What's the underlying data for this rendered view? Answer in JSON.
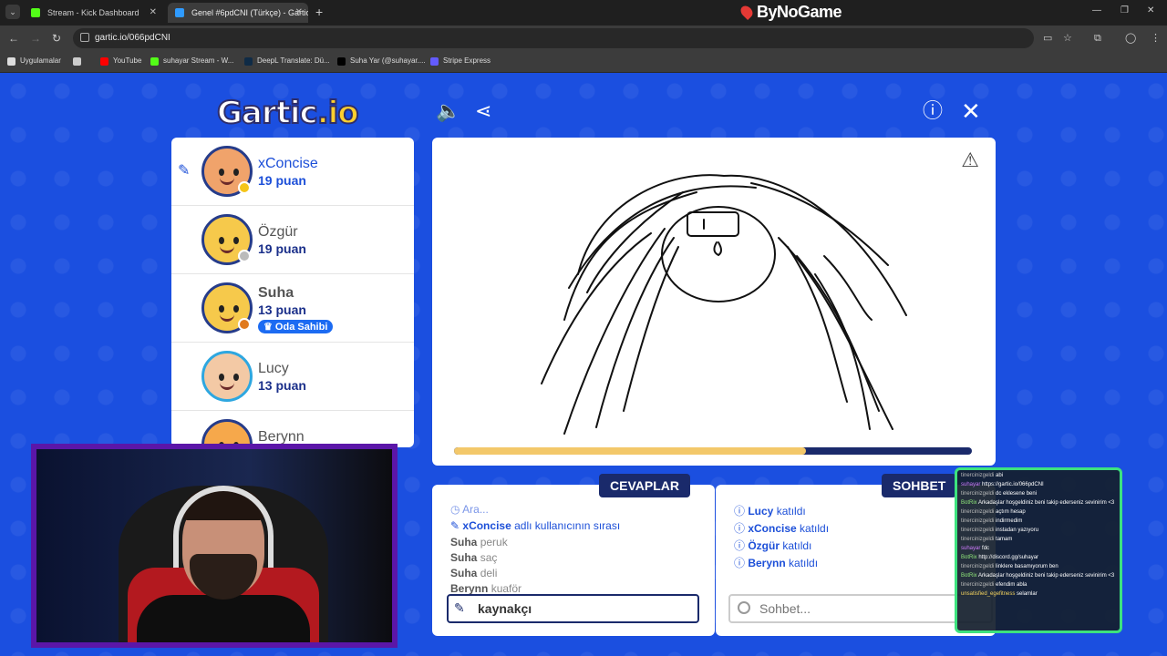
{
  "browser": {
    "tabs": [
      {
        "label": "Stream - Kick Dashboard",
        "fav_color": "#53fc18"
      },
      {
        "label": "Genel #6pdCNI (Türkçe) - Gartic",
        "fav_color": "#2f9bff"
      }
    ],
    "brand": "ByNoGame",
    "url": "gartic.io/066pdCNI",
    "bookmarks": [
      {
        "label": "Uygulamalar",
        "color": "#ffffff"
      },
      {
        "label": "",
        "color": "#cccccc"
      },
      {
        "label": "YouTube",
        "color": "#ff0000"
      },
      {
        "label": "suhayar Stream - W...",
        "color": "#53fc18"
      },
      {
        "label": "DeepL Translate: Dü...",
        "color": "#0f2b46"
      },
      {
        "label": "Suha Yar (@suhayar....",
        "color": "#000000"
      },
      {
        "label": "Stripe Express",
        "color": "#635bff"
      }
    ]
  },
  "game": {
    "logo_main": "Gartic",
    "logo_suffix": ".io",
    "players": [
      {
        "name": "xConcise",
        "points": "19 puan",
        "active": true,
        "status_color": "#f5c518",
        "skin": "#f0a36b"
      },
      {
        "name": "Özgür",
        "points": "19 puan",
        "active": false,
        "status_color": "#bbbbbb",
        "skin": "#f6c94b"
      },
      {
        "name": "Suha",
        "points": "13 puan",
        "active": false,
        "status_color": "#e07a1f",
        "skin": "#f6c94b",
        "badge": "Oda Sahibi"
      },
      {
        "name": "Lucy",
        "points": "13 puan",
        "active": false,
        "status_color": "",
        "skin": "#f3c9a5"
      },
      {
        "name": "Berynn",
        "points": "",
        "active": false,
        "status_color": "",
        "skin": "#f6a84b"
      }
    ],
    "timer_progress": 0.68,
    "answers_tab": "CEVAPLAR",
    "chat_tab": "SOHBET",
    "answers": [
      {
        "user": "",
        "text": "Ara...",
        "type": "system"
      },
      {
        "user": "xConcise",
        "text": "adlı kullanıcının sırası",
        "type": "turn"
      },
      {
        "user": "Suha",
        "text": "peruk",
        "type": "guess"
      },
      {
        "user": "Suha",
        "text": "saç",
        "type": "guess"
      },
      {
        "user": "Suha",
        "text": "deli",
        "type": "guess"
      },
      {
        "user": "Berynn",
        "text": "kuaför",
        "type": "guess"
      }
    ],
    "answer_input_value": "kaynakçı",
    "chat": [
      {
        "user": "Lucy",
        "text": "katıldı"
      },
      {
        "user": "xConcise",
        "text": "katıldı"
      },
      {
        "user": "Özgür",
        "text": "katıldı"
      },
      {
        "user": "Berynn",
        "text": "katıldı"
      }
    ],
    "chat_placeholder": "Sohbet..."
  },
  "stream_chat": [
    {
      "user": "tinercinizgeldi",
      "text": "abi",
      "kind": "u"
    },
    {
      "user": "suhayar",
      "text": "https://gartic.io/066pdCNI",
      "kind": "me"
    },
    {
      "user": "tinercinizgeldi",
      "text": "dc eklesene beni",
      "kind": "u"
    },
    {
      "user": "BotRix",
      "text": "Arkadaşlar hoşgeldiniz beni takip ederseniz sevinirim <3",
      "kind": "bot"
    },
    {
      "user": "tinercinizgeldi",
      "text": "açtım hesap",
      "kind": "u"
    },
    {
      "user": "tinercinizgeldi",
      "text": "indirmedim",
      "kind": "u"
    },
    {
      "user": "tinercinizgeldi",
      "text": "instadan yazıyoru",
      "kind": "u"
    },
    {
      "user": "tinercinizgeldi",
      "text": "tamam",
      "kind": "u"
    },
    {
      "user": "suhayar",
      "text": "fdc",
      "kind": "me"
    },
    {
      "user": "BotRix",
      "text": "http://discord.gg/suhayar",
      "kind": "bot"
    },
    {
      "user": "tinercinizgeldi",
      "text": "linklere basamıyorum ben",
      "kind": "u"
    },
    {
      "user": "BotRix",
      "text": "Arkadaşlar hoşgeldiniz beni takip ederseniz sevinirim <3",
      "kind": "bot"
    },
    {
      "user": "tinercinizgeldi",
      "text": "efendim abla",
      "kind": "u"
    },
    {
      "user": "unsatisfied_egefitness",
      "text": "selamlar",
      "kind": "yel"
    }
  ]
}
